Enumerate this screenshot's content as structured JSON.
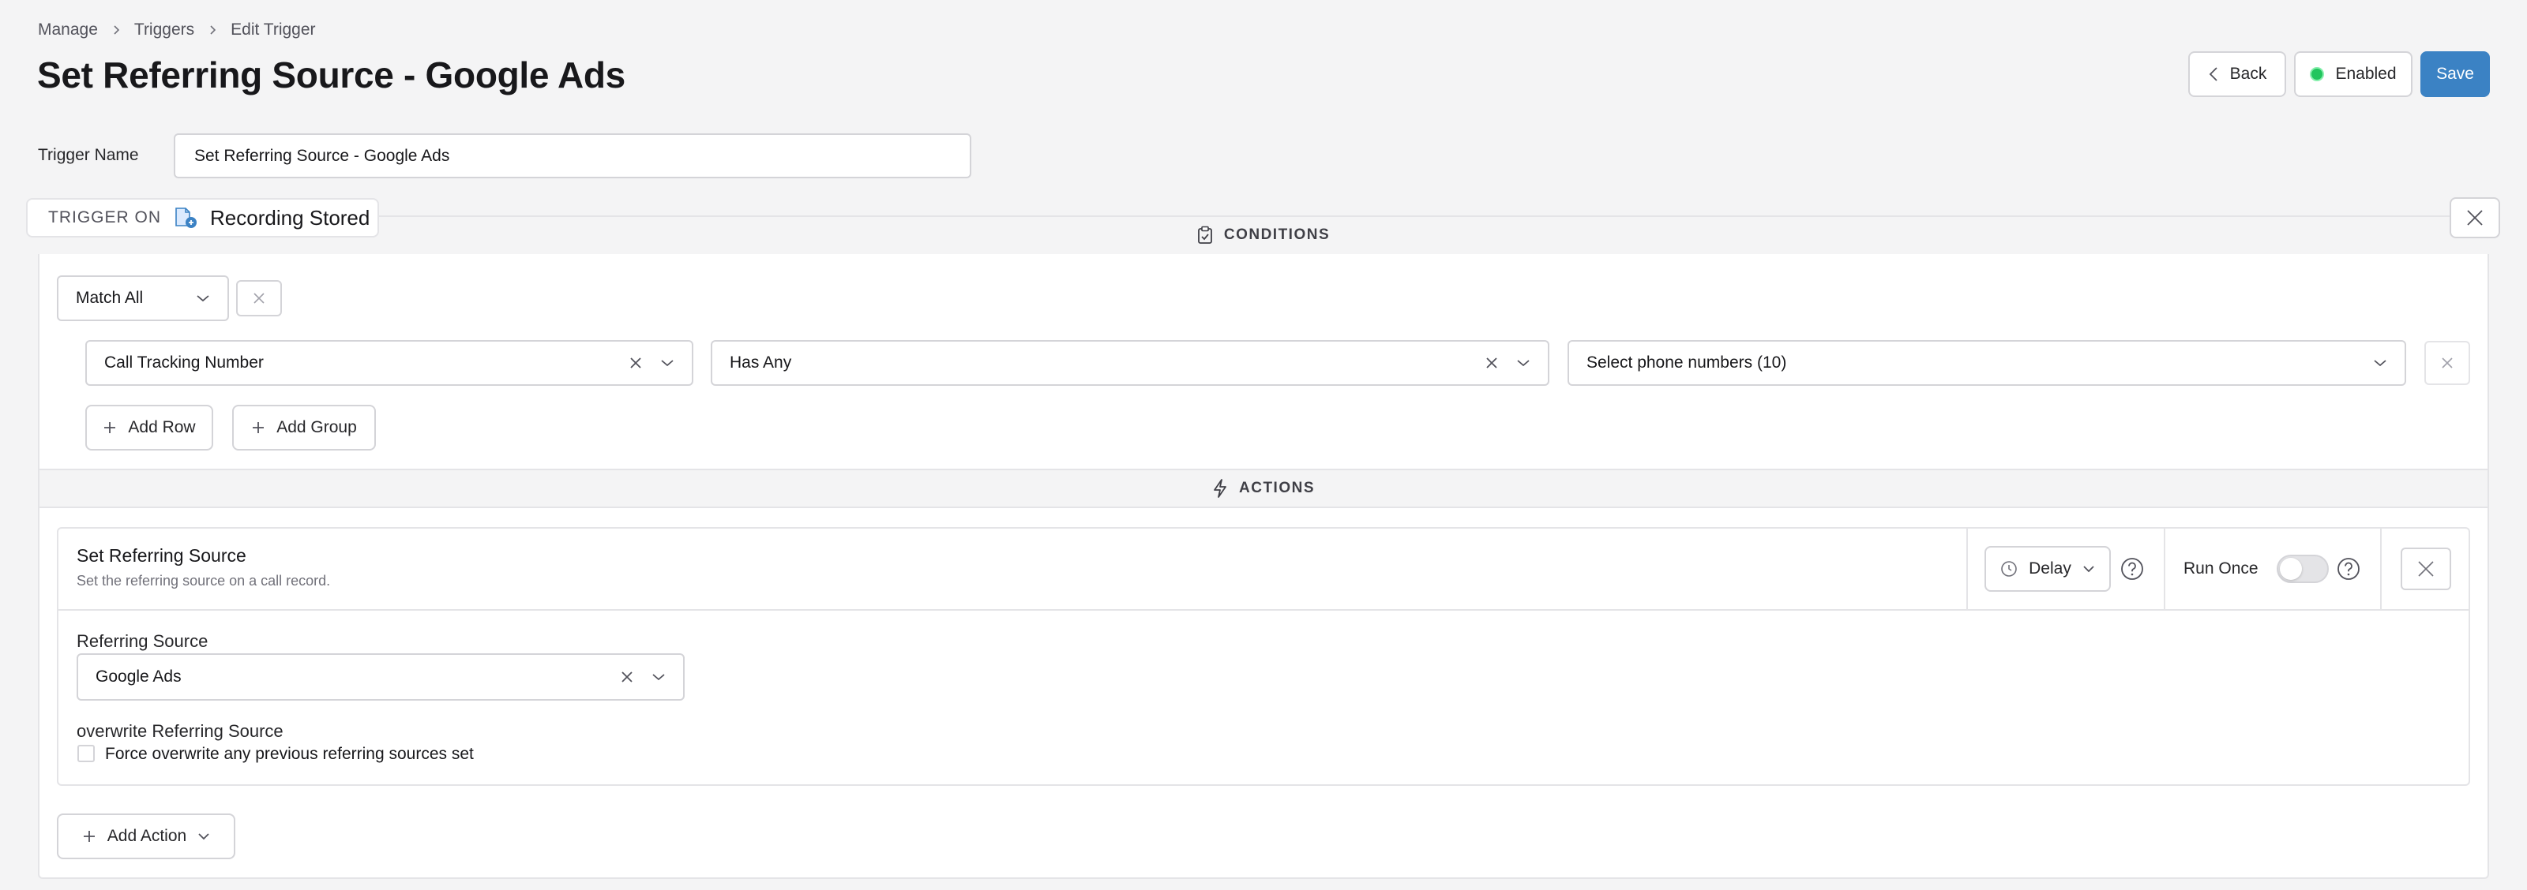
{
  "breadcrumb": [
    "Manage",
    "Triggers",
    "Edit Trigger"
  ],
  "page_title": "Set Referring Source - Google Ads",
  "header_buttons": {
    "back": "Back",
    "enabled": "Enabled",
    "save": "Save"
  },
  "colors": {
    "accent": "#3b82c4",
    "enabled_dot": "#22c55e",
    "trigger_icon": "#3b82c4"
  },
  "trigger_name": {
    "label": "Trigger Name",
    "value": "Set Referring Source - Google Ads"
  },
  "trigger_on": {
    "label": "TRIGGER ON",
    "value": "Recording Stored",
    "icon": "recording-file-icon"
  },
  "conditions": {
    "header": "CONDITIONS",
    "match": "Match All",
    "row": {
      "field": "Call Tracking Number",
      "operator": "Has Any",
      "value": "Select phone numbers (10)"
    },
    "add_row": "Add Row",
    "add_group": "Add Group"
  },
  "actions": {
    "header": "ACTIONS",
    "card": {
      "title": "Set Referring Source",
      "description": "Set the referring source on a call record.",
      "delay": "Delay",
      "run_once": "Run Once",
      "run_once_enabled": false,
      "referring_source_label": "Referring Source",
      "referring_source_value": "Google Ads",
      "overwrite_label": "overwrite Referring Source",
      "overwrite_checkbox_label": "Force overwrite any previous referring sources set",
      "overwrite_checked": false
    },
    "add_action": "Add Action"
  }
}
